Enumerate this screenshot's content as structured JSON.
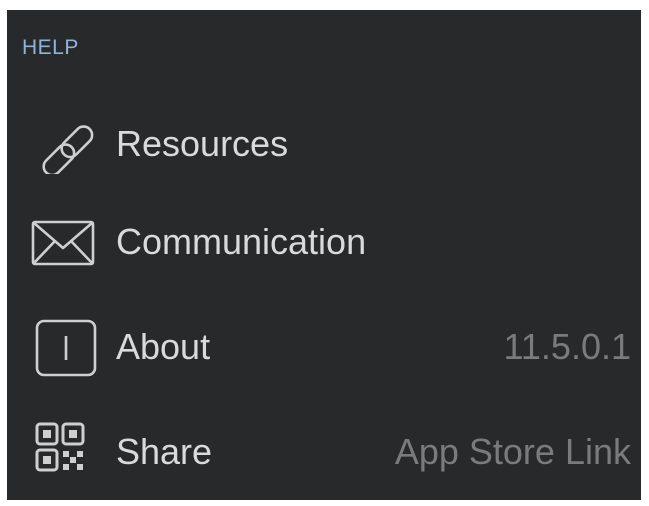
{
  "help_section": {
    "header": "HELP",
    "items": [
      {
        "label": "Resources",
        "icon": "link-icon",
        "value": ""
      },
      {
        "label": "Communication",
        "icon": "envelope-icon",
        "value": ""
      },
      {
        "label": "About",
        "icon": "info-box-icon",
        "value": "11.5.0.1"
      },
      {
        "label": "Share",
        "icon": "qr-code-icon",
        "value": "App Store Link"
      }
    ]
  },
  "colors": {
    "background": "#28292b",
    "header": "#8fb4dc",
    "label": "#dadada",
    "value": "#7b7b7d",
    "icon": "#cfcfcf"
  }
}
